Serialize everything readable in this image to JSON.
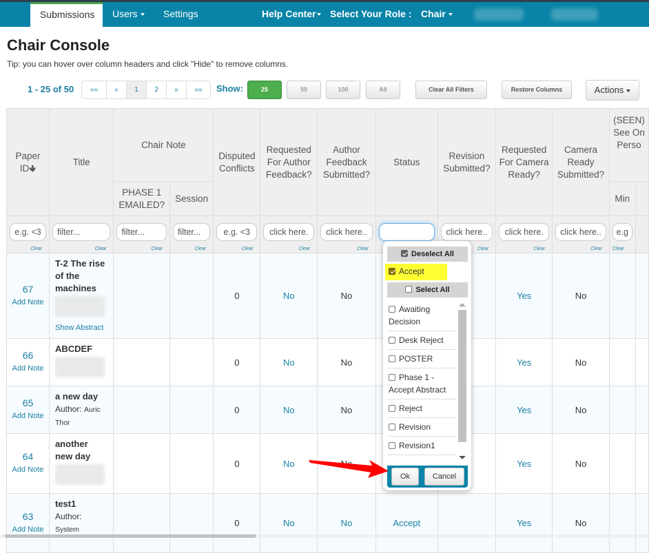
{
  "nav": {
    "items": [
      {
        "label": "Submissions",
        "active": true
      },
      {
        "label": "Users",
        "dropdown": true
      },
      {
        "label": "Settings"
      }
    ],
    "help_center": "Help Center",
    "role_label": "Select Your Role :",
    "role_value": "Chair"
  },
  "page": {
    "title": "Chair Console",
    "tip": "Tip: you can hover over column headers and click \"Hide\" to remove columns."
  },
  "pagination": {
    "summary": "1 - 25 of 50",
    "buttons": [
      "««",
      "«",
      "1",
      "2",
      "»",
      "»»"
    ],
    "current_page": "1",
    "show_label": "Show:",
    "page_sizes": [
      "25",
      "50",
      "100",
      "All"
    ],
    "selected_size": "25"
  },
  "toolbar": {
    "clear_filters": "Clear All Filters",
    "restore_columns": "Restore Columns",
    "actions": "Actions"
  },
  "table": {
    "headers": {
      "paper_id": "Paper ID",
      "title": "Title",
      "chair_note": "Chair Note",
      "phase1": "PHASE 1 EMAILED?",
      "session": "Session",
      "disputed": "Disputed Conflicts",
      "req_feedback": "Requested For Author Feedback?",
      "feedback_sub": "Author Feedback Submitted?",
      "status": "Status",
      "revision_sub": "Revision Submitted?",
      "req_camera": "Requested For Camera Ready?",
      "camera_sub": "Camera Ready Submitted?",
      "seen_group": "(SEEN) See On Perso",
      "min": "Min"
    },
    "filters": {
      "paper_id": "e.g. <3",
      "title": "filter...",
      "phase1": "filter...",
      "session": "filter...",
      "disputed": "e.g. <3",
      "req_feedback": "click here.",
      "feedback_sub": "click here..",
      "status": "",
      "revision_sub": "click here..",
      "req_camera": "click here.",
      "camera_sub": "click here..",
      "min": "e.g",
      "clear_label": "Clear"
    },
    "add_note_label": "Add Note",
    "show_abstract_label": "Show Abstract",
    "rows": [
      {
        "id": "67",
        "title": "T-2 The rise of the machines",
        "author": "",
        "author_blurred": true,
        "show_abstract": true,
        "disputed": "0",
        "req_feedback": "No",
        "feedback_sub": "No",
        "status": "",
        "req_camera": "Yes",
        "camera_sub": "No"
      },
      {
        "id": "66",
        "title": "ABCDEF",
        "author": "",
        "author_blurred": true,
        "show_abstract": false,
        "disputed": "0",
        "req_feedback": "No",
        "feedback_sub": "No",
        "status": "",
        "req_camera": "Yes",
        "camera_sub": "No"
      },
      {
        "id": "65",
        "title": "a new day",
        "author_prefix": "Author:",
        "author": "Auric Thor",
        "author_blurred": false,
        "show_abstract": false,
        "disputed": "0",
        "req_feedback": "No",
        "feedback_sub": "No",
        "status": "",
        "req_camera": "Yes",
        "camera_sub": "No"
      },
      {
        "id": "64",
        "title": "another new day",
        "author": "",
        "author_blurred": true,
        "show_abstract": false,
        "disputed": "0",
        "req_feedback": "No",
        "feedback_sub": "No",
        "status": "",
        "req_camera": "Yes",
        "camera_sub": "No"
      },
      {
        "id": "63",
        "title": "test1",
        "author_prefix": "Author:",
        "author": "System",
        "author_blurred": false,
        "show_abstract": false,
        "disputed": "0",
        "req_feedback": "No",
        "feedback_sub": "No",
        "status": "Accept",
        "req_camera": "Yes",
        "camera_sub": "No"
      }
    ]
  },
  "status_dropdown": {
    "deselect_all": "Deselect All",
    "selected": [
      {
        "label": "Accept",
        "checked": true
      }
    ],
    "select_all": "Select All",
    "options": [
      {
        "label": "Awaiting Decision",
        "checked": false
      },
      {
        "label": "Desk Reject",
        "checked": false
      },
      {
        "label": "POSTER",
        "checked": false
      },
      {
        "label": "Phase 1 - Accept Abstract",
        "checked": false
      },
      {
        "label": "Reject",
        "checked": false
      },
      {
        "label": "Revision",
        "checked": false
      },
      {
        "label": "Revision1",
        "checked": false
      }
    ],
    "ok": "Ok",
    "cancel": "Cancel"
  },
  "annotation": {
    "arrow_color": "#ff0000",
    "highlight_color": "#ffff33"
  }
}
